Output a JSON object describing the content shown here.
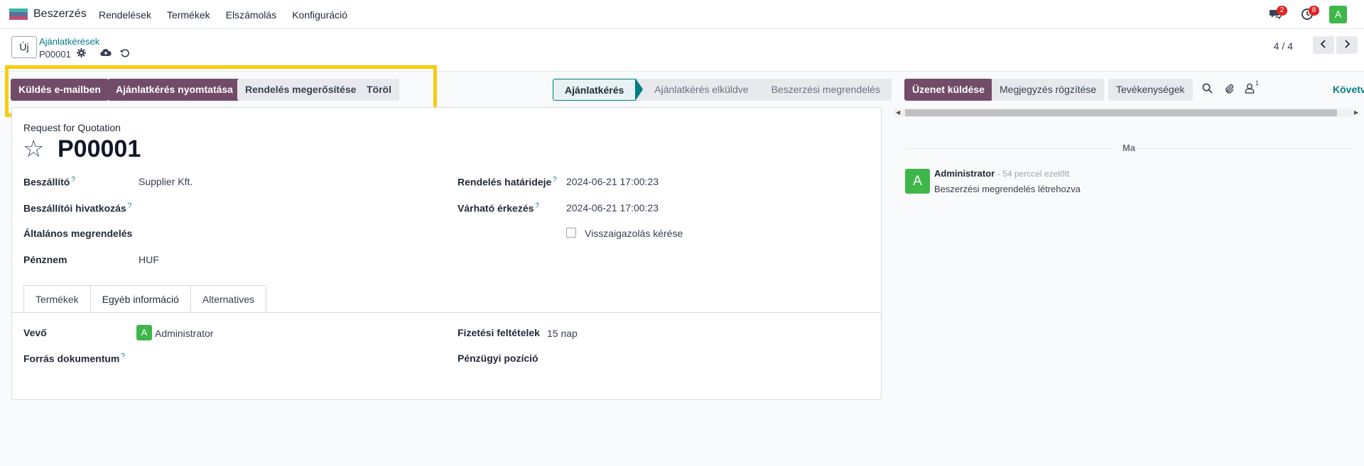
{
  "navbar": {
    "app_name": "Beszerzés",
    "menu": [
      "Rendelések",
      "Termékek",
      "Elszámolás",
      "Konfiguráció"
    ],
    "messages_badge": "2",
    "activities_badge": "8",
    "user_initial": "A",
    "logo_colors": [
      "#3fb6a8",
      "#5c6f9a",
      "#c04d72"
    ]
  },
  "control": {
    "new_button": "Új",
    "breadcrumb": "Ajánlatkérések",
    "record": "P00001",
    "pager": "4 / 4"
  },
  "actions": {
    "send_email": "Küldés e-mailben",
    "print": "Ajánlatkérés nyomtatása",
    "confirm": "Rendelés megerősítése",
    "cancel": "Töröl"
  },
  "statusbar": {
    "stages": [
      "Ajánlatkérés",
      "Ajánlatkérés elküldve",
      "Beszerzési megrendelés"
    ],
    "active_index": 0
  },
  "form": {
    "document_type": "Request for Quotation",
    "title": "P00001",
    "fields_left": [
      {
        "label": "Beszállító",
        "help": "?",
        "value": "Supplier Kft."
      },
      {
        "label": "Beszállítói hivatkozás",
        "help": "?",
        "value": ""
      },
      {
        "label": "Általános megrendelés",
        "help": "",
        "value": ""
      },
      {
        "label": "Pénznem",
        "help": "",
        "value": "HUF"
      }
    ],
    "fields_right": [
      {
        "label": "Rendelés határideje",
        "help": "?",
        "value": "2024-06-21 17:00:23"
      },
      {
        "label": "Várható érkezés",
        "help": "?",
        "value": "2024-06-21 17:00:23"
      }
    ],
    "ack_checkbox_label": "Visszaigazolás kérése",
    "ack_checked": false,
    "tabs": [
      "Termékek",
      "Egyéb információ",
      "Alternatives"
    ],
    "active_tab": 1,
    "tab_fields": {
      "buyer_label": "Vevő",
      "buyer_value": "Administrator",
      "buyer_initial": "A",
      "source_label": "Forrás dokumentum",
      "source_help": "?",
      "payment_terms_label": "Fizetési feltételek",
      "payment_terms_value": "15 nap",
      "fiscal_position_label": "Pénzügyi pozíció"
    }
  },
  "chatter": {
    "send_message": "Üzenet küldése",
    "log_note": "Megjegyzés rögzítése",
    "activities": "Tevékenységek",
    "followers_count": "1",
    "follow": "Követve",
    "day_separator": "Ma",
    "message": {
      "author": "Administrator",
      "time": "- 54 perccel ezelőtt",
      "avatar_initial": "A",
      "body": "Beszerzési megrendelés létrehozva"
    }
  },
  "colors": {
    "primary": "#714b67",
    "accent": "#017e84",
    "highlight": "#f7cd0e",
    "avatar": "#3fb64a"
  }
}
